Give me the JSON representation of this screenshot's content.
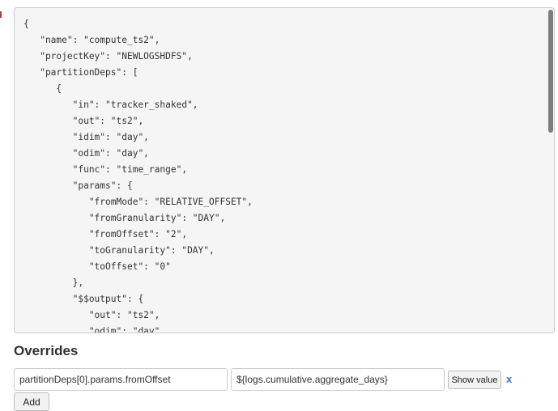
{
  "code_panel": {
    "lines": [
      "{",
      "   \"name\": \"compute_ts2\",",
      "   \"projectKey\": \"NEWLOGSHDFS\",",
      "   \"partitionDeps\": [",
      "      {",
      "         \"in\": \"tracker_shaked\",",
      "         \"out\": \"ts2\",",
      "         \"idim\": \"day\",",
      "         \"odim\": \"day\",",
      "         \"func\": \"time_range\",",
      "         \"params\": {",
      "            \"fromMode\": \"RELATIVE_OFFSET\",",
      "            \"fromGranularity\": \"DAY\",",
      "            \"fromOffset\": \"2\",",
      "            \"toGranularity\": \"DAY\",",
      "            \"toOffset\": \"0\"",
      "         },",
      "         \"$$output\": {",
      "            \"out\": \"ts2\",",
      "            \"odim\": \"day\","
    ]
  },
  "overrides": {
    "title": "Overrides",
    "key_value": "partitionDeps[0].params.fromOffset",
    "value_value": "${logs.cumulative.aggregate_days}",
    "show_value_label": "Show value",
    "remove_label": "x",
    "add_label": "Add"
  }
}
